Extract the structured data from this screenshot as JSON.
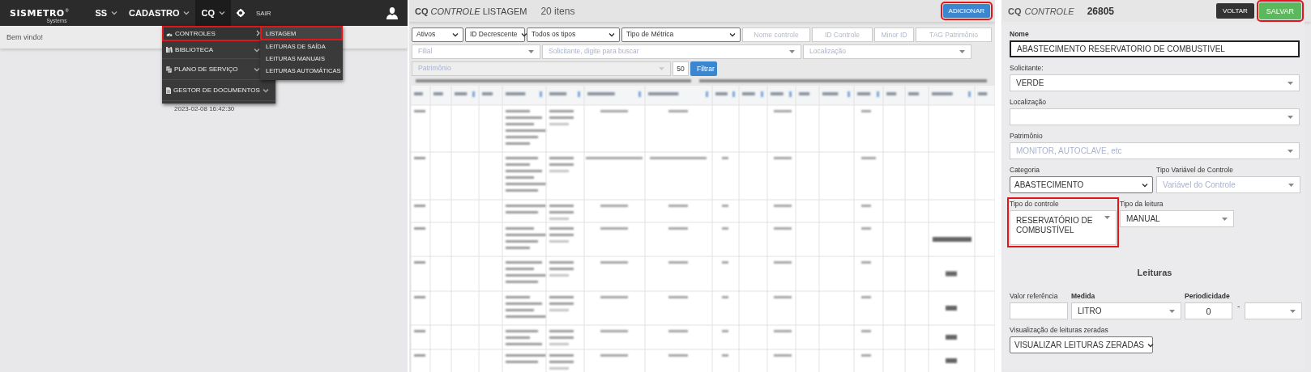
{
  "nav_panel": {
    "logo": {
      "name": "SISMETRO",
      "mark": "®",
      "subtitle": "Systems"
    },
    "menu": [
      {
        "kind": "dropdown",
        "label": "SS",
        "active": false
      },
      {
        "kind": "dropdown",
        "label": "CADASTRO",
        "active": false
      },
      {
        "kind": "dropdown",
        "label": "CQ",
        "active": true
      },
      {
        "kind": "icon",
        "active": false
      },
      {
        "kind": "link",
        "label": "SAIR",
        "active": false
      }
    ],
    "welcome": "Bem vindo!",
    "dropdown": [
      {
        "label": "CONTROLES",
        "expanded": true,
        "highlighted": true
      },
      {
        "label": "BIBLIOTECA",
        "expanded": false,
        "highlighted": false
      },
      {
        "label": "PLANO DE SERVIÇO",
        "expanded": false,
        "highlighted": false
      },
      {
        "label": "GESTOR DE DOCUMENTOS",
        "expanded": false,
        "highlighted": false
      }
    ],
    "submenu": [
      {
        "label": "LISTAGEM",
        "selected": true,
        "highlighted": true
      },
      {
        "label": "LEITURAS DE SAÍDA",
        "selected": false,
        "highlighted": false
      },
      {
        "label": "LEITURAS MANUAIS",
        "selected": false,
        "highlighted": false
      },
      {
        "label": "LEITURAS AUTOMÁTICAS",
        "selected": false,
        "highlighted": false
      }
    ],
    "timestamp": "2023-02-08 16:42:30"
  },
  "list_panel": {
    "title": {
      "module": "CQ",
      "entity": "CONTROLE",
      "view": "LISTAGEM"
    },
    "count": "20 itens",
    "add_button": {
      "label": "ADICIONAR",
      "highlighted": true
    },
    "filter_rows": [
      [
        {
          "kind": "select",
          "value": "Ativos"
        },
        {
          "kind": "select",
          "value": "ID Decrescente"
        },
        {
          "kind": "select",
          "value": "Todos os tipos"
        },
        {
          "kind": "select",
          "value": "Tipo de Métrica"
        },
        {
          "kind": "input",
          "placeholder": "Nome controle"
        },
        {
          "kind": "input",
          "placeholder": "ID Controle"
        },
        {
          "kind": "input",
          "placeholder": "Minor ID"
        },
        {
          "kind": "input",
          "placeholder": "TAG Patrimônio"
        }
      ],
      [
        {
          "kind": "search-select",
          "placeholder": "Filial",
          "disabled": false
        },
        {
          "kind": "search-select",
          "placeholder": "Solicitante, digite para buscar",
          "disabled": false
        },
        {
          "kind": "search-select",
          "placeholder": "Localização",
          "disabled": false
        }
      ],
      [
        {
          "kind": "search-select",
          "placeholder": "Patrimônio",
          "disabled": true
        },
        {
          "kind": "input",
          "value": "50"
        },
        {
          "kind": "button",
          "label": "Filtrar"
        }
      ]
    ]
  },
  "form_panel": {
    "title": {
      "module": "CQ",
      "entity": "CONTROLE",
      "id": "26805"
    },
    "buttons": [
      {
        "kind": "secondary",
        "label": "VOLTAR",
        "highlighted": false
      },
      {
        "kind": "primary",
        "label": "SALVAR",
        "highlighted": true
      }
    ],
    "rows": [
      [
        {
          "label": "Nome",
          "kind": "input",
          "value": "ABASTECIMENTO RESERVATORIO DE COMBUSTIVEL",
          "focused": true
        }
      ],
      [
        {
          "label": "Solicitante:",
          "kind": "search-select",
          "value": "VERDE"
        }
      ],
      [
        {
          "label": "Localização",
          "kind": "search-select"
        }
      ],
      [
        {
          "label": "Patrimônio",
          "kind": "search-select",
          "placeholder": "MONITOR, AUTOCLAVE, etc"
        }
      ],
      [
        {
          "label": "Categoria",
          "kind": "select",
          "value": "ABASTECIMENTO"
        },
        {
          "label": "Tipo Variável de Controle",
          "kind": "search-select",
          "placeholder": "Variável do Controle"
        }
      ],
      [
        {
          "label": "Tipo do controle",
          "kind": "search-select",
          "value": "RESERVATÓRIO DE COMBUSTÍVEL",
          "highlighted": true
        },
        {
          "label": "Tipo da leitura",
          "kind": "search-select",
          "value": "MANUAL"
        }
      ]
    ],
    "readings": {
      "title": "Leituras",
      "rows": [
        [
          {
            "label": "Valor referência",
            "kind": "input"
          },
          {
            "label": "Medida",
            "kind": "search-select",
            "value": "LITRO"
          },
          {
            "label": "Periodicidade",
            "kind": "input",
            "value": "0"
          },
          {
            "kind": "separator",
            "text": "-"
          },
          {
            "kind": "search-select"
          }
        ],
        [
          {
            "label": "Visualização de leituras zeradas",
            "kind": "select",
            "value": "VISUALIZAR LEITURAS ZERADAS"
          }
        ]
      ]
    }
  }
}
